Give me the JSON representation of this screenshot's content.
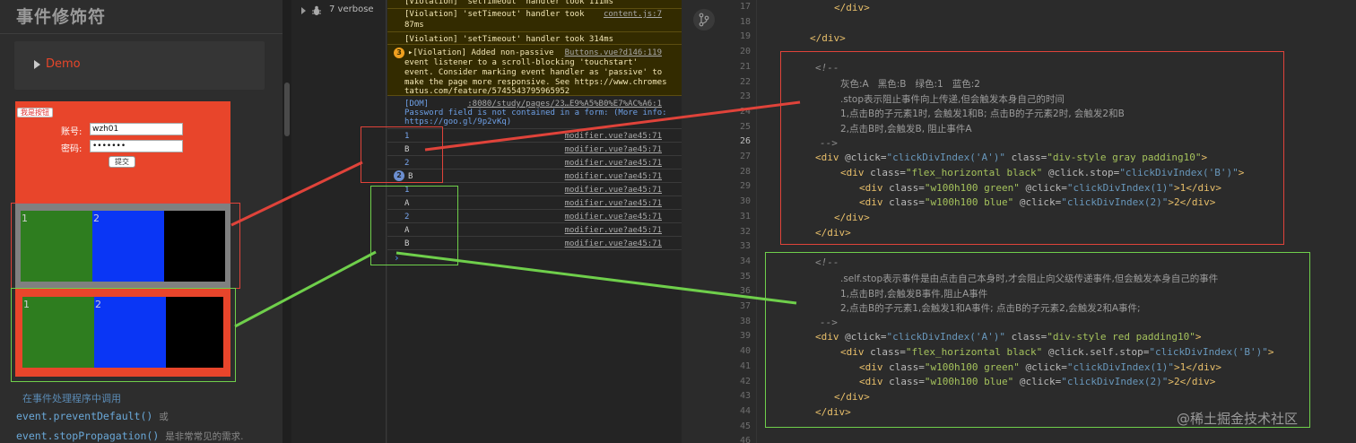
{
  "left": {
    "title": "事件修饰符",
    "demo_label": "Demo",
    "form": {
      "tag_button": "我是按钮",
      "account_label": "账号:",
      "account_value": "wzh01",
      "password_label": "密码:",
      "password_value": "•••••••",
      "submit_label": "提交"
    },
    "demo1": {
      "cell1": "1",
      "cell2": "2"
    },
    "demo2": {
      "cell1": "1",
      "cell2": "2"
    },
    "notes": {
      "line1": "在事件处理程序中调用",
      "line2_code": "event.preventDefault()",
      "line2_tail": "或",
      "line3_code": "event.stopPropagation()",
      "line3_tail": "是非常常见的需求."
    }
  },
  "console": {
    "verbose_label": "7 verbose",
    "rows": [
      {
        "msg": "[Violation] 'setTimeout' handler took 111ms",
        "src": ""
      },
      {
        "msg": "[Violation] 'setTimeout' handler took",
        "msg2": "87ms",
        "src": "content.js:7"
      },
      {
        "msg": "[Violation] 'setTimeout' handler took 314ms",
        "src": ""
      },
      {
        "badge": "3",
        "msg": "▸[Violation] Added non-passive",
        "src": "Buttons.vue?d146:119",
        "msg2": "event listener to a scroll-blocking 'touchstart'",
        "msg3": "event. Consider marking event handler as 'passive' to",
        "msg4": "make the page more responsive. See https://www.chromes",
        "msg5": "tatus.com/feature/5745543795965952"
      },
      {
        "msg": "[DOM]",
        "src": ":8080/study/pages/23…E9%A5%B0%E7%AC%A6:1",
        "msg2": "Password field is not contained in a form: (More info:",
        "msg3": "https://goo.gl/9p2vKq)"
      },
      {
        "msg": "1",
        "src": "modifier.vue?ae45:71"
      },
      {
        "msg": "B",
        "src": "modifier.vue?ae45:71"
      },
      {
        "msg": "2",
        "src": "modifier.vue?ae45:71"
      },
      {
        "badge": "2",
        "msg": "B",
        "src": "modifier.vue?ae45:71"
      },
      {
        "msg": "1",
        "src": "modifier.vue?ae45:71"
      },
      {
        "msg": "A",
        "src": "modifier.vue?ae45:71"
      },
      {
        "msg": "2",
        "src": "modifier.vue?ae45:71"
      },
      {
        "msg": "A",
        "src": "modifier.vue?ae45:71"
      },
      {
        "msg": "B",
        "src": "modifier.vue?ae45:71"
      }
    ],
    "prompt": "›"
  },
  "editor": {
    "line_numbers": [
      "17",
      "18",
      "19",
      "20",
      "21",
      "22",
      "23",
      "24",
      "25",
      "26",
      "27",
      "28",
      "29",
      "30",
      "31",
      "32",
      "33",
      "34",
      "35",
      "36",
      "37",
      "38",
      "39",
      "40",
      "41",
      "42",
      "43",
      "44",
      "45",
      "46"
    ],
    "current_line": "26",
    "lines": {
      "l17": "</div>",
      "l19": "</div>",
      "l21": "<!--",
      "l22": "灰色:A   黑色:B   绿色:1   蓝色:2",
      "l23": ".stop表示阻止事件向上传递,但会触发本身自己的时间",
      "l24": "1,点击B的子元素1时, 会触发1和B; 点击B的子元素2时, 会触发2和B",
      "l25": "2,点击B时,会触发B, 阻止事件A",
      "l26": "-->",
      "l27_tag": "<div",
      "l27_evt": "@click=",
      "l27_val": "\"clickDivIndex('A')\"",
      "l27_cls": "class=",
      "l27_clsv": "\"div-style gray padding10\"",
      "l27_end": ">",
      "l28_tag": "<div",
      "l28_cls": "class=",
      "l28_clsv": "\"flex_horizontal black\"",
      "l28_evt": "@click.stop=",
      "l28_val": "\"clickDivIndex('B')\"",
      "l28_end": ">",
      "l29_a": "<div",
      "l29_b": "class=",
      "l29_c": "\"w100h100 green\"",
      "l29_d": "@click=",
      "l29_e": "\"clickDivIndex(1)\"",
      "l29_f": ">1</div>",
      "l30_a": "<div",
      "l30_b": "class=",
      "l30_c": "\"w100h100 blue\"",
      "l30_d": "@click=",
      "l30_e": "\"clickDivIndex(2)\"",
      "l30_f": ">2</div>",
      "l31": "</div>",
      "l32": "</div>",
      "l34": "<!--",
      "l35": ".self.stop表示事件是由点击自己本身时,才会阻止向父级传递事件,但会触发本身自己的事件",
      "l36": "1,点击B时,会触发B事件,阻止A事件",
      "l37": "2,点击B的子元素1,会触发1和A事件; 点击B的子元素2,会触发2和A事件;",
      "l38": "-->",
      "l39_tag": "<div",
      "l39_evt": "@click=",
      "l39_val": "\"clickDivIndex('A')\"",
      "l39_cls": "class=",
      "l39_clsv": "\"div-style red padding10\"",
      "l39_end": ">",
      "l40_tag": "<div",
      "l40_cls": "class=",
      "l40_clsv": "\"flex_horizontal black\"",
      "l40_evt": "@click.self.stop=",
      "l40_val": "\"clickDivIndex('B')\"",
      "l40_end": ">",
      "l41_a": "<div",
      "l41_b": "class=",
      "l41_c": "\"w100h100 green\"",
      "l41_d": "@click=",
      "l41_e": "\"clickDivIndex(1)\"",
      "l41_f": ">1</div>",
      "l42_a": "<div",
      "l42_b": "class=",
      "l42_c": "\"w100h100 blue\"",
      "l42_d": "@click=",
      "l42_e": "\"clickDivIndex(2)\"",
      "l42_f": ">2</div>",
      "l43": "</div>",
      "l44": "</div>"
    }
  },
  "watermark": "@稀土掘金技术社区",
  "colors": {
    "form_bg": "#e8452b",
    "gray_box": "#808080",
    "red_box": "#e8452b",
    "green": "#2e7d1f",
    "blue": "#0a36f5",
    "black": "#000000",
    "annotation_red": "#e0433a",
    "annotation_green": "#6fcf4b"
  }
}
